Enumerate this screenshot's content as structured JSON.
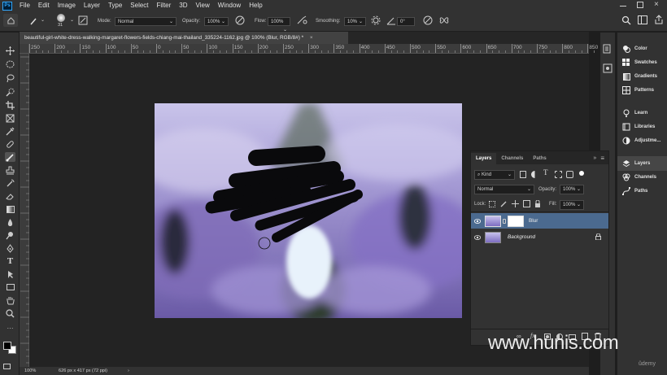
{
  "menu": {
    "items": [
      "File",
      "Edit",
      "Image",
      "Layer",
      "Type",
      "Select",
      "Filter",
      "3D",
      "View",
      "Window",
      "Help"
    ],
    "logo": "Ps"
  },
  "options": {
    "brush_size": "31",
    "mode_label": "Mode:",
    "mode_value": "Normal",
    "opacity_label": "Opacity:",
    "opacity_value": "100%",
    "flow_label": "Flow:",
    "flow_value": "100%",
    "smoothing_label": "Smoothing:",
    "smoothing_value": "10%",
    "angle_value": "0°"
  },
  "document": {
    "tab_title": "beautiful-girl-white-dress-walking-margaret-flowers-fields-chiang-mai-thailand_335224-1162.jpg @ 100% (Blur, RGB/8#) *",
    "close": "×"
  },
  "ruler": {
    "top_labels": [
      "250",
      "200",
      "150",
      "100",
      "50",
      "0",
      "50",
      "100",
      "150",
      "200",
      "250",
      "300",
      "350",
      "400",
      "450",
      "500",
      "550",
      "600",
      "650",
      "700",
      "750",
      "800",
      "850"
    ]
  },
  "status": {
    "zoom": "100%",
    "dimensions": "626 px x 417 px (72 ppi)",
    "arrow": "›"
  },
  "right_panels": {
    "group1": [
      "Color",
      "Swatches",
      "Gradients",
      "Patterns"
    ],
    "group2": [
      "Learn",
      "Libraries",
      "Adjustme..."
    ],
    "group3": [
      "Layers",
      "Channels",
      "Paths"
    ]
  },
  "layers_panel": {
    "tabs": [
      "Layers",
      "Channels",
      "Paths"
    ],
    "kind_label": "Kind",
    "blend_mode": "Normal",
    "opacity_label": "Opacity:",
    "opacity_value": "100%",
    "lock_label": "Lock:",
    "fill_label": "Fill:",
    "fill_value": "100%",
    "layers": [
      {
        "name": "Blur",
        "selected": true
      },
      {
        "name": "Background",
        "selected": false
      }
    ]
  },
  "watermark": "www.hunis.com",
  "brand": "ûdemy",
  "colors": {
    "accent": "#31a8ff",
    "selected_layer": "#4b6a8f",
    "ui_dark": "#323232"
  }
}
